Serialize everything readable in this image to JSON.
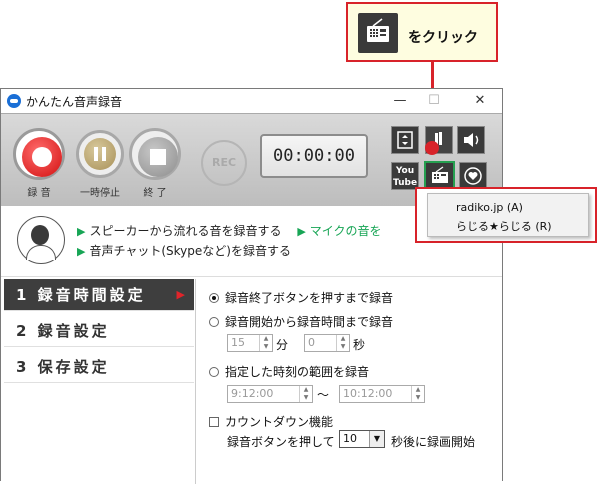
{
  "callout": {
    "text": "をクリック"
  },
  "window": {
    "title": "かんたん音声録音",
    "controls": {
      "minimize": "—",
      "maximize": "☐",
      "close": "✕"
    }
  },
  "toolbar": {
    "record_label": "録 音",
    "pause_label": "一時停止",
    "stop_label": "終 了",
    "rec_indicator": "REC",
    "timer": "00:00:00",
    "youtube_label": "You Tube"
  },
  "description": {
    "line1_text": "スピーカーから流れる音を録音する",
    "line1_mic": "マイクの音を",
    "line2_text": "音声チャット(Skypeなど)を録音する",
    "bullet": "▶"
  },
  "sidebar": {
    "items": [
      {
        "label": "1 録音時間設定"
      },
      {
        "label": "2 録音設定"
      },
      {
        "label": "3 保存設定"
      }
    ]
  },
  "form": {
    "opt1": "録音終了ボタンを押すまで録音",
    "opt2": "録音開始から録音時間まで録音",
    "minutes_value": "15",
    "minutes_unit": "分",
    "seconds_value": "0",
    "seconds_unit": "秒",
    "opt3": "指定した時刻の範囲を録音",
    "time_from": "9:12:00",
    "tilde": "～",
    "time_to": "10:12:00",
    "countdown": "カウントダウン機能",
    "countdown_prefix": "録音ボタンを押して",
    "countdown_value": "10",
    "countdown_suffix": "秒後に録画開始"
  },
  "popup": {
    "items": [
      "radiko.jp (A)",
      "らじる★らじる (R)"
    ]
  }
}
